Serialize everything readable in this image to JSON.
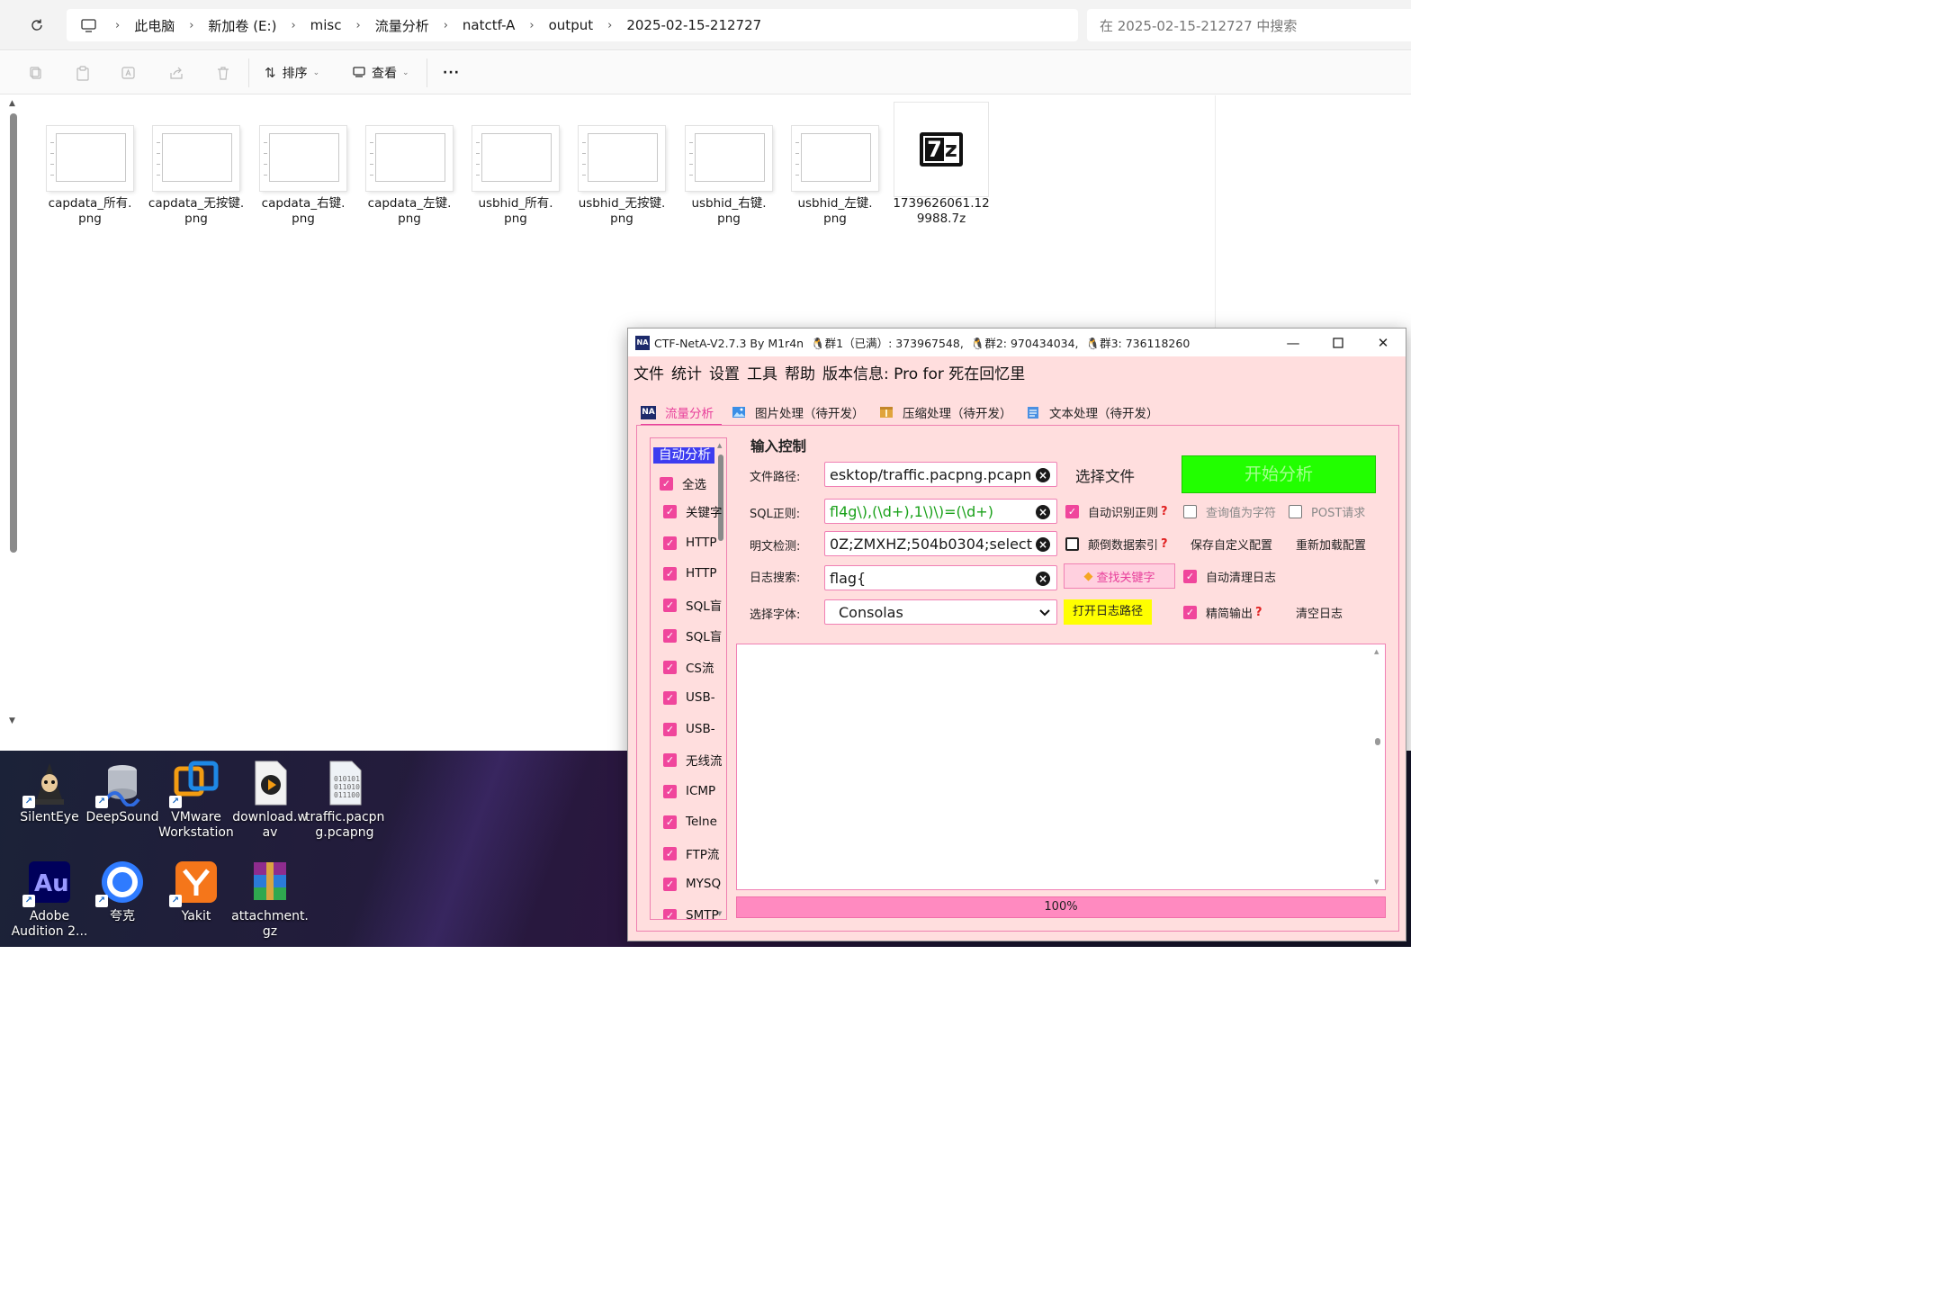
{
  "explorer": {
    "breadcrumbs": [
      "此电脑",
      "新加卷 (E:)",
      "misc",
      "流量分析",
      "natctf-A",
      "output",
      "2025-02-15-212727"
    ],
    "search_placeholder": "在 2025-02-15-212727 中搜索",
    "toolbar": {
      "sort_label": "排序",
      "view_label": "查看",
      "more_label": "···"
    },
    "files": [
      {
        "name": "capdata_所有.png",
        "type": "png"
      },
      {
        "name": "capdata_无按键.png",
        "type": "png"
      },
      {
        "name": "capdata_右键.png",
        "type": "png"
      },
      {
        "name": "capdata_左键.png",
        "type": "png"
      },
      {
        "name": "usbhid_所有.png",
        "type": "png"
      },
      {
        "name": "usbhid_无按键.png",
        "type": "png"
      },
      {
        "name": "usbhid_右键.png",
        "type": "png"
      },
      {
        "name": "usbhid_左键.png",
        "type": "png"
      },
      {
        "name": "1739626061.129988.7z",
        "type": "7z"
      }
    ],
    "file_labels": [
      [
        "capdata_所有.",
        "png"
      ],
      [
        "capdata_无按键.",
        "png"
      ],
      [
        "capdata_右键.",
        "png"
      ],
      [
        "capdata_左键.",
        "png"
      ],
      [
        "usbhid_所有.",
        "png"
      ],
      [
        "usbhid_无按键.",
        "png"
      ],
      [
        "usbhid_右键.",
        "png"
      ],
      [
        "usbhid_左键.",
        "png"
      ],
      [
        "1739626061.12",
        "9988.7z"
      ]
    ]
  },
  "desktop": {
    "icons": [
      {
        "l1": "SilentEye",
        "l2": ""
      },
      {
        "l1": "DeepSound",
        "l2": ""
      },
      {
        "l1": "VMware",
        "l2": "Workstation"
      },
      {
        "l1": "download.w",
        "l2": "av"
      },
      {
        "l1": "traffic.pacpn",
        "l2": "g.pcapng"
      },
      {
        "l1": "Adobe",
        "l2": "Audition 2..."
      },
      {
        "l1": "夸克",
        "l2": ""
      },
      {
        "l1": "Yakit",
        "l2": ""
      },
      {
        "l1": "attachment.",
        "l2": "gz"
      }
    ]
  },
  "app": {
    "title": "CTF-NetA-V2.7.3 By M1r4n",
    "group1": "群1（已满）: 373967548,",
    "group2": "群2: 970434034,",
    "group3": "群3: 736118260",
    "menu": [
      "文件",
      "统计",
      "设置",
      "工具",
      "帮助",
      "版本信息: Pro for 死在回忆里"
    ],
    "tabs": [
      "流量分析",
      "图片处理（待开发）",
      "压缩处理（待开发）",
      "文本处理（待开发）"
    ],
    "sidebar": {
      "header": "自动分析",
      "select_all": "全选",
      "items": [
        "关键字",
        "HTTP",
        "HTTP",
        "SQL盲",
        "SQL盲",
        "CS流",
        "USB-",
        "USB-",
        "无线流",
        "ICMP",
        "Telne",
        "FTP流",
        "MYSQ",
        "SMTP"
      ]
    },
    "input": {
      "section_title": "输入控制",
      "file_path_label": "文件路径:",
      "file_path_value": "esktop/traffic.pacpng.pcapng",
      "choose_file": "选择文件",
      "start_button": "开始分析",
      "sql_label": "SQL正则:",
      "sql_value": "fl4g\\),(\\d+),1\\)\\)=(\\d+)",
      "plain_label": "明文检测:",
      "plain_value": "0Z;ZMXHZ;504b0304;select",
      "log_label": "日志搜索:",
      "log_value": "flag{",
      "font_label": "选择字体:",
      "font_value": "Consolas",
      "auto_regex": "自动识别正则",
      "query_as_char": "查询值为字符",
      "post_request": "POST请求",
      "reverse_index": "颠倒数据索引",
      "save_config": "保存自定义配置",
      "reload_config": "重新加载配置",
      "find_keyword": "查找关键字",
      "auto_clear_log": "自动清理日志",
      "open_log_path": "打开日志路径",
      "concise_output": "精简输出",
      "clear_log": "清空日志",
      "help_mark": "?"
    },
    "progress": "100%",
    "progress_value": 100,
    "colors": {
      "start_button": "#22ff00",
      "open_log": "#ffff00",
      "accent": "#e8409b"
    }
  }
}
